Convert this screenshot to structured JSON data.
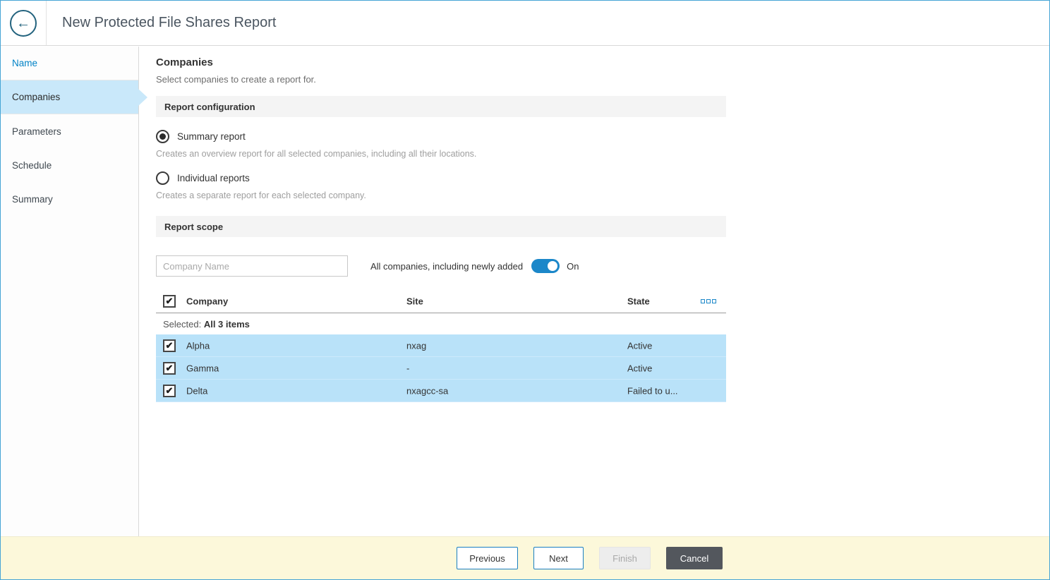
{
  "header": {
    "title": "New Protected File Shares Report",
    "back_icon": "←"
  },
  "sidebar": {
    "items": [
      {
        "label": "Name",
        "state": "completed"
      },
      {
        "label": "Companies",
        "state": "active"
      },
      {
        "label": "Parameters",
        "state": "upcoming"
      },
      {
        "label": "Schedule",
        "state": "upcoming"
      },
      {
        "label": "Summary",
        "state": "upcoming"
      }
    ]
  },
  "main": {
    "title": "Companies",
    "subtitle": "Select companies to create a report for.",
    "report_configuration": {
      "section_title": "Report configuration",
      "options": [
        {
          "label": "Summary report",
          "description": "Creates an overview report for all selected companies, including all their locations.",
          "selected": true
        },
        {
          "label": "Individual reports",
          "description": "Creates a separate report for each selected company.",
          "selected": false
        }
      ]
    },
    "report_scope": {
      "section_title": "Report scope",
      "search_placeholder": "Company Name",
      "toggle_label": "All companies, including newly added",
      "toggle_on": true,
      "toggle_state": "On",
      "table": {
        "columns": [
          "Company",
          "Site",
          "State"
        ],
        "header_checkbox_checked": true,
        "selected_label": "Selected:",
        "selected_value": "All 3 items",
        "rows": [
          {
            "checked": true,
            "company": "Alpha",
            "site": "nxag",
            "state": "Active"
          },
          {
            "checked": true,
            "company": "Gamma",
            "site": "-",
            "state": "Active"
          },
          {
            "checked": true,
            "company": "Delta",
            "site": "nxagcc-sa",
            "state": "Failed to u..."
          }
        ]
      }
    }
  },
  "footer": {
    "buttons": [
      {
        "label": "Previous",
        "enabled": true
      },
      {
        "label": "Next",
        "enabled": true
      },
      {
        "label": "Finish",
        "enabled": false
      },
      {
        "label": "Cancel",
        "enabled": true
      }
    ]
  },
  "icons": {
    "check": "✔"
  },
  "colors": {
    "accent_blue": "#1a7fc1",
    "sidebar_active_bg": "#c9e8fa",
    "row_highlight": "#b9e2f9",
    "footer_bg": "#fcf8da",
    "cancel_button_bg": "#53575d",
    "back_icon_color": "#23637e"
  }
}
